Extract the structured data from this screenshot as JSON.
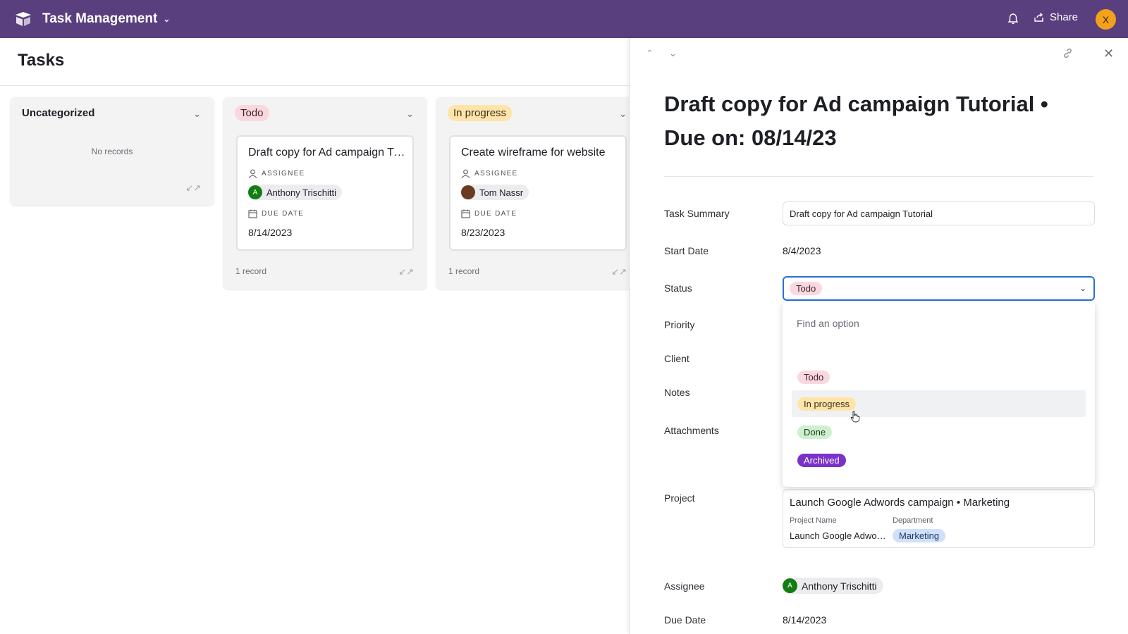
{
  "app": {
    "title": "Task Management",
    "share_label": "Share",
    "user_initial": "X",
    "icons": {
      "logo": "base-logo-icon",
      "bell": "bell-icon",
      "share": "share-icon"
    }
  },
  "page": {
    "title": "Tasks"
  },
  "columns": [
    {
      "name": "Uncategorized",
      "empty_text": "No records"
    },
    {
      "name": "Todo",
      "color": "#fbd7df",
      "count_text": "1 record",
      "card": {
        "title": "Draft copy for Ad campaign Tutorial",
        "assignee_label": "ASSIGNEE",
        "assignee": "Anthony Trischitti",
        "assignee_initial": "A",
        "due_label": "DUE DATE",
        "due_date": "8/14/2023"
      }
    },
    {
      "name": "In progress",
      "color": "#ffe4a8",
      "count_text": "1 record",
      "card": {
        "title": "Create wireframe for website",
        "assignee_label": "ASSIGNEE",
        "assignee": "Tom Nassr",
        "due_label": "DUE DATE",
        "due_date": "8/23/2023"
      }
    }
  ],
  "record": {
    "title": "Draft copy for Ad campaign Tutorial • Due on: 08/14/23",
    "fields": {
      "task_summary": {
        "label": "Task Summary",
        "value": "Draft copy for Ad campaign Tutorial"
      },
      "start_date": {
        "label": "Start Date",
        "value": "8/4/2023"
      },
      "status": {
        "label": "Status",
        "value": "Todo"
      },
      "priority": {
        "label": "Priority"
      },
      "client": {
        "label": "Client"
      },
      "notes": {
        "label": "Notes"
      },
      "attachments": {
        "label": "Attachments"
      },
      "project": {
        "label": "Project",
        "title": "Launch Google Adwords campaign • Marketing",
        "name_label": "Project Name",
        "name_value": "Launch Google Adwords campaign",
        "dept_label": "Department",
        "dept_value": "Marketing"
      },
      "assignee": {
        "label": "Assignee",
        "value": "Anthony Trischitti",
        "initial": "A"
      },
      "due_date": {
        "label": "Due Date",
        "value": "8/14/2023"
      }
    },
    "status_dropdown": {
      "search_placeholder": "Find an option",
      "options": [
        "Todo",
        "In progress",
        "Done",
        "Archived"
      ],
      "hovered": "In progress"
    }
  },
  "colors": {
    "topbar": "#5a3f7f",
    "todo": "#fbd7df",
    "in_progress": "#ffe4a8",
    "done": "#cdf0cf",
    "archived": "#7a32c7",
    "focus": "#2a6fd6"
  }
}
